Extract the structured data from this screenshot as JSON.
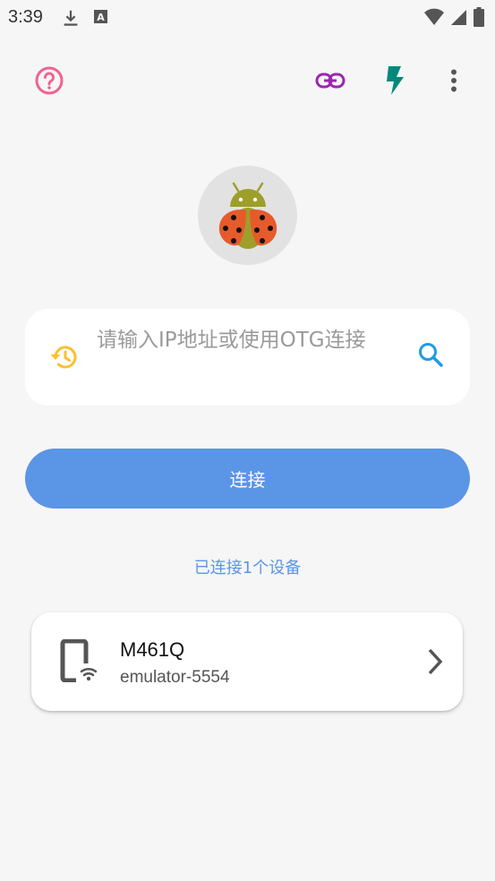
{
  "status_bar": {
    "time": "3:39",
    "icons": [
      "download-icon",
      "text-a-icon",
      "wifi-icon",
      "signal-icon",
      "battery-icon"
    ]
  },
  "toolbar": {
    "help_icon": "help-circle-icon",
    "link_icon": "link-icon",
    "flash_icon": "flash-icon",
    "more_icon": "more-vert-icon"
  },
  "colors": {
    "help": "#f06292",
    "link": "#9c27b0",
    "flash": "#00897b",
    "history": "#fbc02d",
    "search": "#1e9be9",
    "accent": "#5b95e6"
  },
  "search": {
    "placeholder": "请输入IP地址或使用OTG连接"
  },
  "connect_button": {
    "label": "连接"
  },
  "connected_info": "已连接1个设备",
  "devices": [
    {
      "name": "M461Q",
      "serial": "emulator-5554"
    }
  ]
}
